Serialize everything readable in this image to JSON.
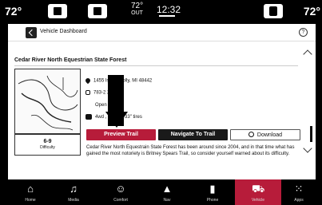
{
  "statusbar": {
    "temp_left": "72°",
    "out_temp": "72°",
    "out_label": "OUT",
    "clock": "12:32",
    "temp_right": "72°"
  },
  "header": {
    "title": "Vehicle Dashboard"
  },
  "trail": {
    "name": "Cedar River North Equestrian State Forest",
    "address": "1455 ls Rd, Holly, MI 48442",
    "phone": "783-2 2",
    "hours": "Open",
    "vehicle": "4wd , at least 33\" tires",
    "difficulty_value": "6-9",
    "difficulty_label": "Difficulty",
    "description": "Cedar River North Equestrain State Forest has been around since 2004, and in that time what has gained the most notoriety is Britney Spears Trail, so consider yourself warned about its difficulty."
  },
  "actions": {
    "preview": "Preview Trail",
    "navigate": "Navigate To Trail",
    "download": "Download"
  },
  "nav": [
    {
      "label": "Home",
      "icon": "home-icon"
    },
    {
      "label": "Media",
      "icon": "music-icon"
    },
    {
      "label": "Comfort",
      "icon": "comfort-icon"
    },
    {
      "label": "Nav",
      "icon": "nav-arrow-icon"
    },
    {
      "label": "Phone",
      "icon": "phone-icon"
    },
    {
      "label": "Vehicle",
      "icon": "vehicle-icon"
    },
    {
      "label": "Apps",
      "icon": "apps-grid-icon"
    }
  ],
  "colors": {
    "accent": "#b71c3a",
    "dark_button": "#1a1a1a"
  }
}
